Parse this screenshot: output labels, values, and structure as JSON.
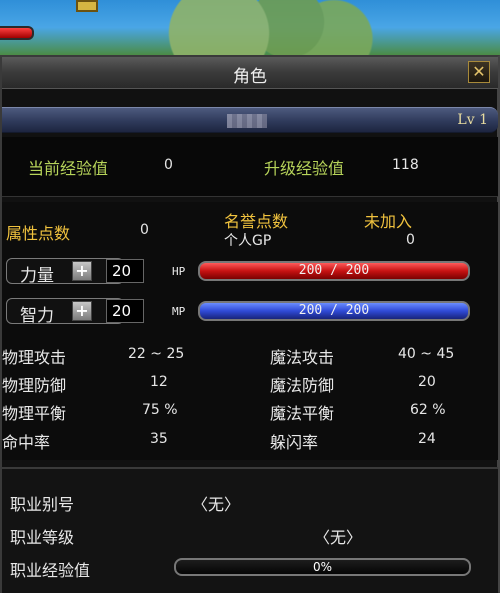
{
  "window": {
    "title": "角色",
    "close_label": "✕"
  },
  "character": {
    "level": "Lv 1"
  },
  "experience": {
    "current_label": "当前经验值",
    "current_value": "0",
    "next_label": "升级经验值",
    "next_value": "118"
  },
  "attributes": {
    "points_label": "属性点数",
    "points_value": "0",
    "reputation_label": "名誉点数",
    "reputation_value": "未加入",
    "gp_label": "个人GP",
    "gp_value": "0",
    "str_label": "力量",
    "str_value": "20",
    "hp_tag": "HP",
    "hp_text": "200 / 200",
    "int_label": "智力",
    "int_value": "20",
    "mp_tag": "MP",
    "mp_text": "200 / 200",
    "stats": [
      {
        "label": "物理攻击",
        "value": "22 ~ 25"
      },
      {
        "label": "物理防御",
        "value": "12"
      },
      {
        "label": "物理平衡",
        "value": "75 %"
      },
      {
        "label": "命中率",
        "value": "35"
      }
    ],
    "magic_stats": [
      {
        "label": "魔法攻击",
        "value": "40 ~ 45"
      },
      {
        "label": "魔法防御",
        "value": "20"
      },
      {
        "label": "魔法平衡",
        "value": "62 %"
      },
      {
        "label": "躲闪率",
        "value": "24"
      }
    ]
  },
  "job": {
    "alias_label": "职业别号",
    "alias_value": "〈无〉",
    "level_label": "职业等级",
    "level_value": "〈无〉",
    "exp_label": "职业经验值",
    "exp_value": "0%"
  },
  "colors": {
    "hp": "#c61212",
    "mp": "#2f4ad6",
    "green_label": "#b7d45a",
    "gold_label": "#f0c23e"
  }
}
